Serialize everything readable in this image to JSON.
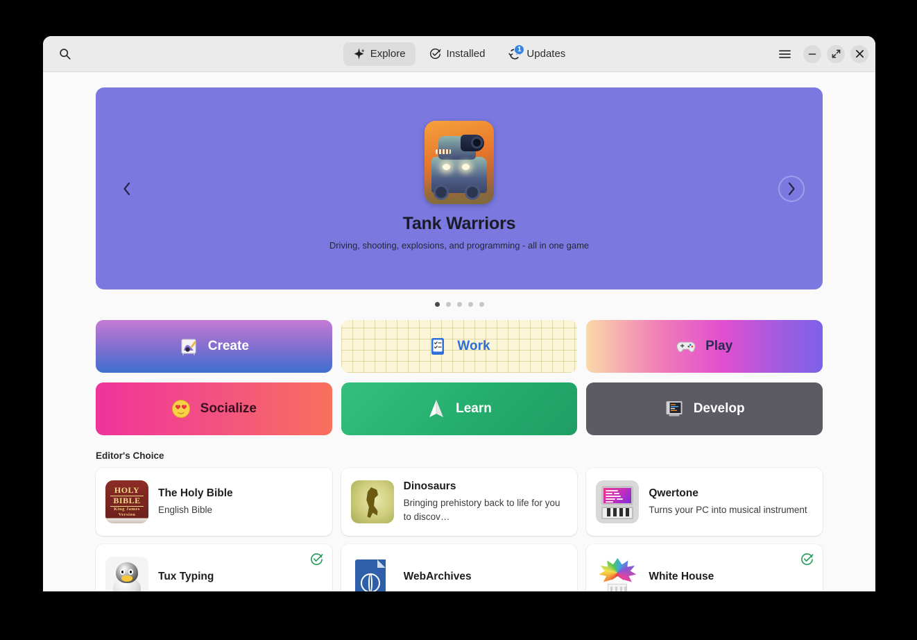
{
  "window": {
    "controls": {
      "menu_label": "Main Menu",
      "minimize_label": "Minimize",
      "maximize_label": "Maximize",
      "close_label": "Close"
    }
  },
  "header": {
    "search_label": "Search",
    "tabs": [
      {
        "label": "Explore",
        "icon": "sparkle-icon",
        "active": true,
        "badge": null
      },
      {
        "label": "Installed",
        "icon": "check-circle-icon",
        "active": false,
        "badge": null
      },
      {
        "label": "Updates",
        "icon": "refresh-icon",
        "active": false,
        "badge": "1"
      }
    ]
  },
  "hero": {
    "title": "Tank Warriors",
    "subtitle": "Driving, shooting, explosions, and programming - all in one game",
    "prev_label": "Previous",
    "next_label": "Next",
    "background_color": "#7b79e0",
    "dots": {
      "count": 5,
      "active_index": 0
    }
  },
  "categories": [
    {
      "label": "Create",
      "icon": "paint-palette-icon",
      "style": "create"
    },
    {
      "label": "Work",
      "icon": "clipboard-check-icon",
      "style": "work"
    },
    {
      "label": "Play",
      "icon": "game-controller-icon",
      "style": "play"
    },
    {
      "label": "Socialize",
      "icon": "heart-eyes-icon",
      "style": "socialize"
    },
    {
      "label": "Learn",
      "icon": "paper-plane-icon",
      "style": "learn"
    },
    {
      "label": "Develop",
      "icon": "terminal-icon",
      "style": "develop"
    }
  ],
  "editors_choice": {
    "section_title": "Editor's Choice",
    "apps": [
      {
        "name": "The Holy Bible",
        "description": "English Bible",
        "icon": "bible-icon",
        "installed": false
      },
      {
        "name": "Dinosaurs",
        "description": "Bringing prehistory back to life for you to discov…",
        "icon": "dinosaur-icon",
        "installed": false
      },
      {
        "name": "Qwertone",
        "description": "Turns your PC into musical instrument",
        "icon": "qwertone-icon",
        "installed": false
      },
      {
        "name": "Tux Typing",
        "description": "",
        "icon": "tux-icon",
        "installed": true
      },
      {
        "name": "WebArchives",
        "description": "",
        "icon": "webarchives-icon",
        "installed": false
      },
      {
        "name": "White House",
        "description": "",
        "icon": "whitehouse-icon",
        "installed": true
      }
    ]
  }
}
